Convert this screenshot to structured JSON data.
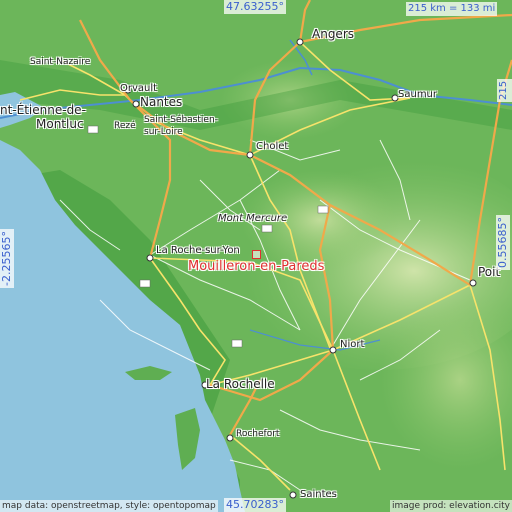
{
  "map": {
    "top_coord": "47.63255°",
    "bottom_coord": "45.70283°",
    "left_coord": "-2.25565°",
    "right_coord": "0.55685°",
    "scale_top": "215 km = 133 mi",
    "scale_right": "215 km = 133 mi",
    "highlight_place": "Mouilleron-en-Pareds",
    "attribution_left": "map data: openstreetmap, style: opentopomap",
    "attribution_right": "image prod: elevation.city",
    "places": {
      "angers": "Angers",
      "saint_nazaire": "Saint-Nazaire",
      "orvault": "Orvault",
      "nantes": "Nantes",
      "saint_etienne_1": "nt-Étienne-de-",
      "saint_etienne_2": "Montluc",
      "reze": "Rezé",
      "saint_sebastien_1": "Saint-Sébastien-",
      "saint_sebastien_2": "sur-Loire",
      "saumur": "Saumur",
      "cholet": "Cholet",
      "mont_mercure": "Mont Mercure",
      "la_roche": "La Roche-sur-Yon",
      "poitiers": "Poit",
      "niort": "Niort",
      "la_rochelle": "La Rochelle",
      "rochefort": "Rochefort",
      "saintes": "Saintes"
    },
    "colors": {
      "sea": "#8fc4de",
      "lowland": "#4ea644",
      "upland": "#b6d78e",
      "motorway": "#f0a94a",
      "road": "#f7e36b",
      "highlight": "#e03030"
    }
  }
}
